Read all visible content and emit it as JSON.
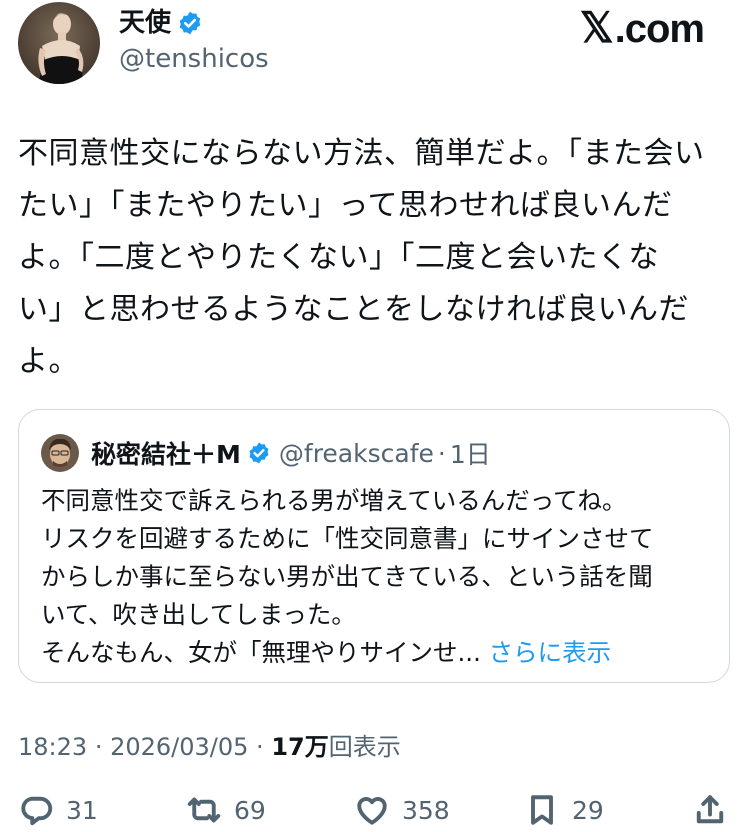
{
  "tweet": {
    "display_name": "天使",
    "handle": "@tenshicos",
    "text": "不同意性交にならない方法、簡単だよ。「また会い\nたい」「またやりたい」って思わせれば良いんだ\nよ。「二度とやりたくない」「二度と会いたくな\nい」と思わせるようなことをしなければ良いんだ\nよ。",
    "time": "18:23",
    "date": "2026/03/05",
    "views_count": "17万",
    "views_label": "回表示"
  },
  "watermark": {
    "x_glyph": "𝕏",
    "label": ".com"
  },
  "quote": {
    "display_name": "秘密結社＋M",
    "handle": "@freakscafe",
    "separator": "·",
    "time": "1日",
    "text": "不同意性交で訴えられる男が増えているんだってね。\nリスクを回避するために「性交同意書」にサインさせて\nからしか事に至らない男が出てきている、という話を聞\nいて、吹き出してしまった。\nそんなもん、女が「無理やりサインせ...",
    "show_more": "さらに表示"
  },
  "actions": {
    "replies": "31",
    "reposts": "69",
    "likes": "358",
    "bookmarks": "29"
  },
  "icons": {
    "verified": "verified-badge-icon",
    "reply": "speech-bubble-icon",
    "repost": "repost-arrows-icon",
    "like": "heart-icon",
    "bookmark": "bookmark-icon",
    "share": "share-upload-icon"
  },
  "colors": {
    "verified_blue": "#1d9bf0",
    "secondary_text": "#536471",
    "border": "#cfd9de"
  }
}
